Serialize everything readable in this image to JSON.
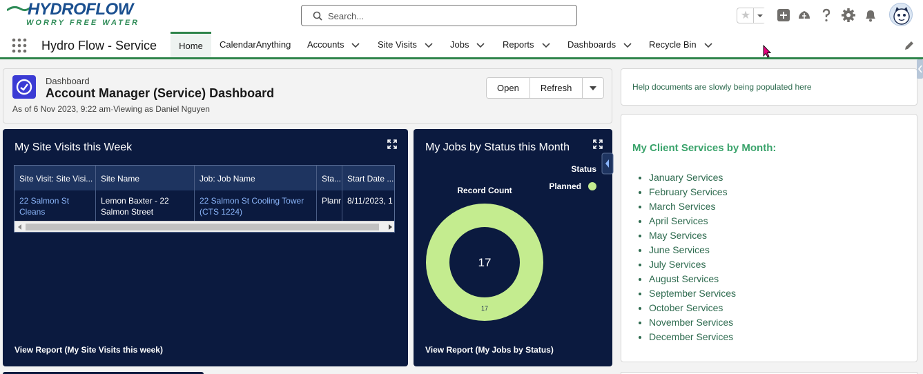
{
  "header": {
    "logo_main": "HYDROFLOW",
    "logo_tagline": "WORRY FREE WATER",
    "search_placeholder": "Search...",
    "accent_color": "#2e844a"
  },
  "nav": {
    "app_name": "Hydro Flow - Service",
    "tabs": [
      {
        "label": "Home",
        "active": true,
        "has_menu": false
      },
      {
        "label": "CalendarAnything",
        "active": false,
        "has_menu": false
      },
      {
        "label": "Accounts",
        "active": false,
        "has_menu": true
      },
      {
        "label": "Site Visits",
        "active": false,
        "has_menu": true
      },
      {
        "label": "Jobs",
        "active": false,
        "has_menu": true
      },
      {
        "label": "Reports",
        "active": false,
        "has_menu": true
      },
      {
        "label": "Dashboards",
        "active": false,
        "has_menu": true
      },
      {
        "label": "Recycle Bin",
        "active": false,
        "has_menu": true
      }
    ]
  },
  "dashboard": {
    "type_label": "Dashboard",
    "title": "Account Manager (Service) Dashboard",
    "meta": "As of 6 Nov 2023, 9:22 am·Viewing as Daniel Nguyen",
    "buttons": {
      "open": "Open",
      "refresh": "Refresh"
    }
  },
  "site_visits": {
    "title": "My Site Visits this Week",
    "columns": [
      "Site Visit: Site Visi...",
      "Site Name",
      "Job: Job Name",
      "Sta...",
      "Start Date ..."
    ],
    "rows": [
      [
        "22 Salmon St Cleans",
        "Lemon Baxter - 22 Salmon Street",
        "22 Salmon St Cooling Tower (CTS 1224)",
        "Planr",
        "8/11/2023, 1"
      ]
    ],
    "view_report": "View Report (My Site Visits this week)"
  },
  "jobs": {
    "title": "My Jobs by Status this Month",
    "legend_title": "Status",
    "view_report": "View Report (My Jobs by Status)"
  },
  "chart_data": {
    "type": "pie",
    "donut": true,
    "title": "Record Count",
    "center_label": "17",
    "legend_title": "Status",
    "legend_position": "top-right",
    "categories": [
      "Planned"
    ],
    "values": [
      17
    ],
    "slice_labels": [
      "17"
    ],
    "colors": [
      "#c4ec8f"
    ]
  },
  "help": {
    "text": "Help documents are slowly being populated here"
  },
  "services": {
    "title": "My Client Services by Month:",
    "items": [
      "January Services",
      "February Services",
      "March Services",
      "April Services",
      "May Services",
      "June Services",
      "July Services",
      "August Services",
      "September Services",
      "October Services",
      "November Services",
      "December Services"
    ]
  }
}
